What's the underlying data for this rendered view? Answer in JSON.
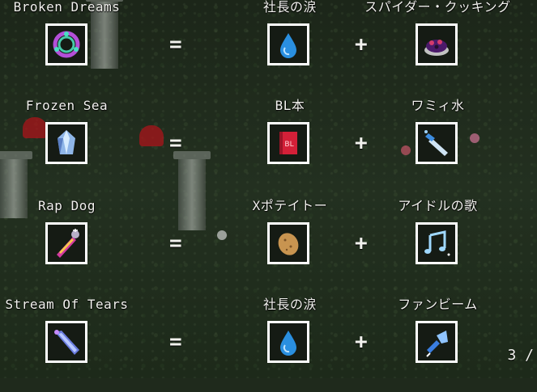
{
  "recipes": [
    {
      "result": {
        "name": "Broken Dreams",
        "icon": "broken-dreams-ring-icon"
      },
      "equals": "=",
      "ingredient1": {
        "name": "社長の涙",
        "icon": "tear-drop-icon"
      },
      "plus": "+",
      "ingredient2": {
        "name": "スパイダー・クッキング",
        "icon": "spider-cooking-icon"
      }
    },
    {
      "result": {
        "name": "Frozen Sea",
        "icon": "ice-crystal-icon"
      },
      "equals": "=",
      "ingredient1": {
        "name": "BL本",
        "icon": "bl-book-icon"
      },
      "plus": "+",
      "ingredient2": {
        "name": "ワミィ水",
        "icon": "spray-bottle-icon"
      }
    },
    {
      "result": {
        "name": "Rap Dog",
        "icon": "microphone-icon"
      },
      "equals": "=",
      "ingredient1": {
        "name": "Xポテイトー",
        "icon": "potato-icon"
      },
      "plus": "+",
      "ingredient2": {
        "name": "アイドルの歌",
        "icon": "music-notes-icon"
      }
    },
    {
      "result": {
        "name": "Stream Of Tears",
        "icon": "tear-stream-icon"
      },
      "equals": "=",
      "ingredient1": {
        "name": "社長の涙",
        "icon": "tear-drop-icon"
      },
      "plus": "+",
      "ingredient2": {
        "name": "ファンビーム",
        "icon": "fan-beam-icon"
      }
    }
  ],
  "pagination": {
    "text": "3 /"
  }
}
